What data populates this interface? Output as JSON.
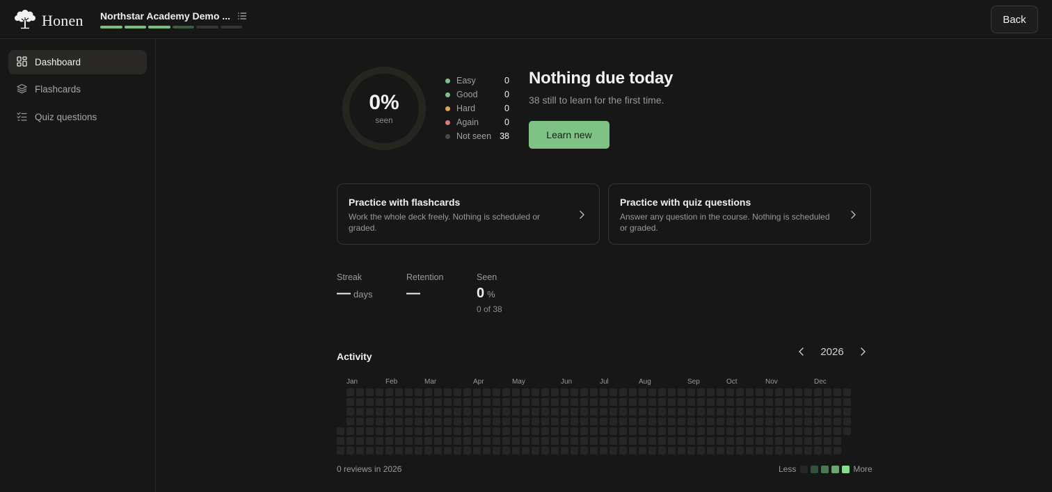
{
  "app": {
    "name": "Honen"
  },
  "header": {
    "course_title": "Northstar Academy Demo ...",
    "progress_segments": [
      "done",
      "done",
      "done",
      "part",
      "empty",
      "empty"
    ],
    "back_label": "Back"
  },
  "sidebar": {
    "items": [
      {
        "label": "Dashboard",
        "icon": "dashboard-icon",
        "active": true
      },
      {
        "label": "Flashcards",
        "icon": "layers-icon",
        "active": false
      },
      {
        "label": "Quiz questions",
        "icon": "checklist-icon",
        "active": false
      }
    ]
  },
  "summary": {
    "percent": "0%",
    "percent_sub": "seen",
    "legend": [
      {
        "label": "Easy",
        "value": "0",
        "color": "#7ec285"
      },
      {
        "label": "Good",
        "value": "0",
        "color": "#7ec285"
      },
      {
        "label": "Hard",
        "value": "0",
        "color": "#e0a44a"
      },
      {
        "label": "Again",
        "value": "0",
        "color": "#e07676"
      },
      {
        "label": "Not seen",
        "value": "38",
        "color": "#4a4a4a"
      }
    ],
    "title": "Nothing due today",
    "subtitle": "38 still to learn for the first time.",
    "learn_label": "Learn new"
  },
  "cards": [
    {
      "title": "Practice with flashcards",
      "desc": "Work the whole deck freely. Nothing is scheduled or graded."
    },
    {
      "title": "Practice with quiz questions",
      "desc": "Answer any question in the course. Nothing is scheduled or graded."
    }
  ],
  "stats": {
    "streak": {
      "label": "Streak",
      "value": "—",
      "unit": "days"
    },
    "retention": {
      "label": "Retention",
      "value": "—"
    },
    "seen": {
      "label": "Seen",
      "value": "0",
      "unit": "%",
      "sub": "0 of 38"
    }
  },
  "activity": {
    "title": "Activity",
    "year": "2026",
    "months": [
      "Jan",
      "Feb",
      "Mar",
      "Apr",
      "May",
      "Jun",
      "Jul",
      "Aug",
      "Sep",
      "Oct",
      "Nov",
      "Dec"
    ],
    "reviews_text": "0 reviews in 2026",
    "less_label": "Less",
    "more_label": "More",
    "scale_colors": [
      "#262624",
      "#33503a",
      "#4a7a52",
      "#66a86e",
      "#86dc8e"
    ]
  }
}
